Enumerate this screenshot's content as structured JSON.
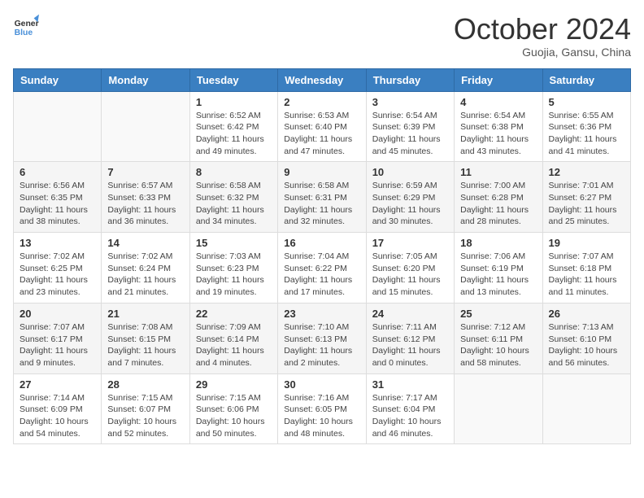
{
  "logo": {
    "line1": "General",
    "line2": "Blue"
  },
  "title": "October 2024",
  "subtitle": "Guojia, Gansu, China",
  "days_of_week": [
    "Sunday",
    "Monday",
    "Tuesday",
    "Wednesday",
    "Thursday",
    "Friday",
    "Saturday"
  ],
  "weeks": [
    [
      {
        "day": "",
        "info": ""
      },
      {
        "day": "",
        "info": ""
      },
      {
        "day": "1",
        "info": "Sunrise: 6:52 AM\nSunset: 6:42 PM\nDaylight: 11 hours and 49 minutes."
      },
      {
        "day": "2",
        "info": "Sunrise: 6:53 AM\nSunset: 6:40 PM\nDaylight: 11 hours and 47 minutes."
      },
      {
        "day": "3",
        "info": "Sunrise: 6:54 AM\nSunset: 6:39 PM\nDaylight: 11 hours and 45 minutes."
      },
      {
        "day": "4",
        "info": "Sunrise: 6:54 AM\nSunset: 6:38 PM\nDaylight: 11 hours and 43 minutes."
      },
      {
        "day": "5",
        "info": "Sunrise: 6:55 AM\nSunset: 6:36 PM\nDaylight: 11 hours and 41 minutes."
      }
    ],
    [
      {
        "day": "6",
        "info": "Sunrise: 6:56 AM\nSunset: 6:35 PM\nDaylight: 11 hours and 38 minutes."
      },
      {
        "day": "7",
        "info": "Sunrise: 6:57 AM\nSunset: 6:33 PM\nDaylight: 11 hours and 36 minutes."
      },
      {
        "day": "8",
        "info": "Sunrise: 6:58 AM\nSunset: 6:32 PM\nDaylight: 11 hours and 34 minutes."
      },
      {
        "day": "9",
        "info": "Sunrise: 6:58 AM\nSunset: 6:31 PM\nDaylight: 11 hours and 32 minutes."
      },
      {
        "day": "10",
        "info": "Sunrise: 6:59 AM\nSunset: 6:29 PM\nDaylight: 11 hours and 30 minutes."
      },
      {
        "day": "11",
        "info": "Sunrise: 7:00 AM\nSunset: 6:28 PM\nDaylight: 11 hours and 28 minutes."
      },
      {
        "day": "12",
        "info": "Sunrise: 7:01 AM\nSunset: 6:27 PM\nDaylight: 11 hours and 25 minutes."
      }
    ],
    [
      {
        "day": "13",
        "info": "Sunrise: 7:02 AM\nSunset: 6:25 PM\nDaylight: 11 hours and 23 minutes."
      },
      {
        "day": "14",
        "info": "Sunrise: 7:02 AM\nSunset: 6:24 PM\nDaylight: 11 hours and 21 minutes."
      },
      {
        "day": "15",
        "info": "Sunrise: 7:03 AM\nSunset: 6:23 PM\nDaylight: 11 hours and 19 minutes."
      },
      {
        "day": "16",
        "info": "Sunrise: 7:04 AM\nSunset: 6:22 PM\nDaylight: 11 hours and 17 minutes."
      },
      {
        "day": "17",
        "info": "Sunrise: 7:05 AM\nSunset: 6:20 PM\nDaylight: 11 hours and 15 minutes."
      },
      {
        "day": "18",
        "info": "Sunrise: 7:06 AM\nSunset: 6:19 PM\nDaylight: 11 hours and 13 minutes."
      },
      {
        "day": "19",
        "info": "Sunrise: 7:07 AM\nSunset: 6:18 PM\nDaylight: 11 hours and 11 minutes."
      }
    ],
    [
      {
        "day": "20",
        "info": "Sunrise: 7:07 AM\nSunset: 6:17 PM\nDaylight: 11 hours and 9 minutes."
      },
      {
        "day": "21",
        "info": "Sunrise: 7:08 AM\nSunset: 6:15 PM\nDaylight: 11 hours and 7 minutes."
      },
      {
        "day": "22",
        "info": "Sunrise: 7:09 AM\nSunset: 6:14 PM\nDaylight: 11 hours and 4 minutes."
      },
      {
        "day": "23",
        "info": "Sunrise: 7:10 AM\nSunset: 6:13 PM\nDaylight: 11 hours and 2 minutes."
      },
      {
        "day": "24",
        "info": "Sunrise: 7:11 AM\nSunset: 6:12 PM\nDaylight: 11 hours and 0 minutes."
      },
      {
        "day": "25",
        "info": "Sunrise: 7:12 AM\nSunset: 6:11 PM\nDaylight: 10 hours and 58 minutes."
      },
      {
        "day": "26",
        "info": "Sunrise: 7:13 AM\nSunset: 6:10 PM\nDaylight: 10 hours and 56 minutes."
      }
    ],
    [
      {
        "day": "27",
        "info": "Sunrise: 7:14 AM\nSunset: 6:09 PM\nDaylight: 10 hours and 54 minutes."
      },
      {
        "day": "28",
        "info": "Sunrise: 7:15 AM\nSunset: 6:07 PM\nDaylight: 10 hours and 52 minutes."
      },
      {
        "day": "29",
        "info": "Sunrise: 7:15 AM\nSunset: 6:06 PM\nDaylight: 10 hours and 50 minutes."
      },
      {
        "day": "30",
        "info": "Sunrise: 7:16 AM\nSunset: 6:05 PM\nDaylight: 10 hours and 48 minutes."
      },
      {
        "day": "31",
        "info": "Sunrise: 7:17 AM\nSunset: 6:04 PM\nDaylight: 10 hours and 46 minutes."
      },
      {
        "day": "",
        "info": ""
      },
      {
        "day": "",
        "info": ""
      }
    ]
  ]
}
